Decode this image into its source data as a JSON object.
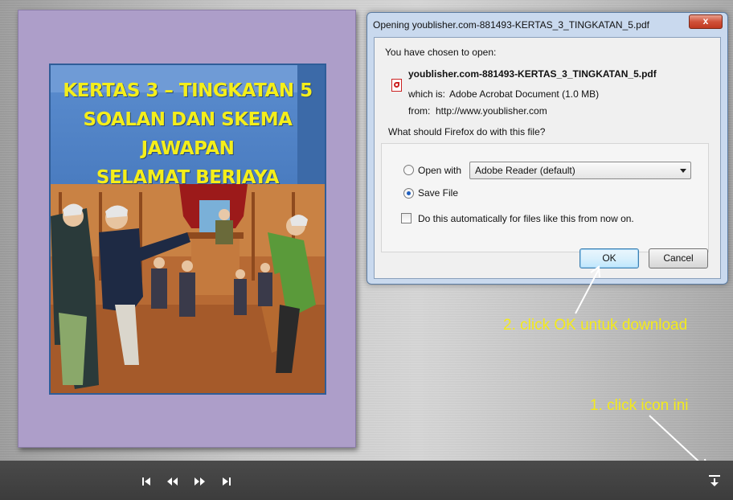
{
  "book": {
    "title_lines": [
      "KERTAS 3 – TINGKATAN 5",
      "SOALAN DAN SKEMA JAWAPAN",
      "SELAMAT BERJAYA"
    ]
  },
  "dialog": {
    "title": "Opening youblisher.com-881493-KERTAS_3_TINGKATAN_5.pdf",
    "close_label": "x",
    "chosen_label": "You have chosen to open:",
    "file_name": "youblisher.com-881493-KERTAS_3_TINGKATAN_5.pdf",
    "which_is_label": "which is:",
    "which_is_value": "Adobe Acrobat Document (1.0 MB)",
    "from_label": "from:",
    "from_value": "http://www.youblisher.com",
    "question": "What should Firefox do with this file?",
    "open_with_label": "Open with",
    "open_with_selected": "Adobe Reader  (default)",
    "save_file_label": "Save File",
    "auto_label": "Do this automatically for files like this from now on.",
    "ok_label": "OK",
    "cancel_label": "Cancel",
    "selected_option": "save_file",
    "auto_checked": false
  },
  "annotations": {
    "step2": "2. click OK untuk download",
    "step1": "1. click icon ini",
    "color": "#f3ea1c"
  },
  "toolbar": {
    "controls": [
      "first-page-icon",
      "previous-page-icon",
      "next-page-icon",
      "last-page-icon"
    ],
    "download_icon": "download-icon"
  }
}
